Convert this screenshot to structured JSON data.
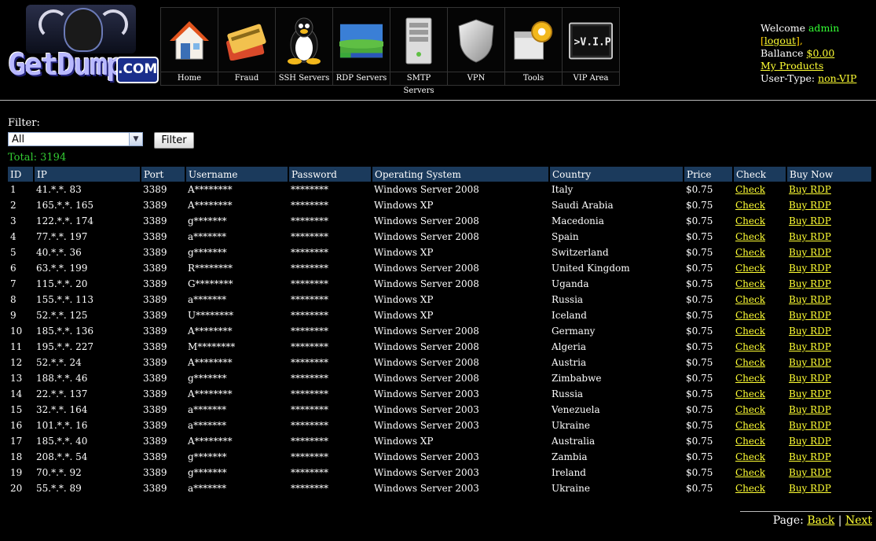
{
  "logo": {
    "text": "GetDumps",
    "suffix": ".COM"
  },
  "nav": [
    {
      "label": "Home",
      "icon": "house-icon"
    },
    {
      "label": "Fraud",
      "icon": "credit-cards-icon"
    },
    {
      "label": "SSH Servers",
      "icon": "linux-penguin-icon"
    },
    {
      "label": "RDP Servers",
      "icon": "windows-desktop-icon"
    },
    {
      "label": "SMTP Servers",
      "icon": "server-tower-icon"
    },
    {
      "label": "VPN",
      "icon": "shield-icon"
    },
    {
      "label": "Tools",
      "icon": "gear-box-icon"
    },
    {
      "label": "VIP Area",
      "icon": "vip-terminal-icon",
      "icon_text": ">V.I.P"
    }
  ],
  "user": {
    "welcome": "Welcome ",
    "username": "admin",
    "logout_pre": " [",
    "logout": "logout",
    "logout_post": "],",
    "balance_label": "Ballance ",
    "balance": "$0.00",
    "my_products": "My Products",
    "usertype_label": "User-Type: ",
    "usertype": "non-VIP"
  },
  "filter": {
    "label": "Filter:",
    "selected": "All",
    "button": "Filter"
  },
  "total": "Total: 3194",
  "table": {
    "headers": [
      "ID",
      "IP",
      "Port",
      "Username",
      "Password",
      "Operating System",
      "Country",
      "Price",
      "Check",
      "Buy Now"
    ],
    "rows": [
      [
        "1",
        "41.*.*. 83",
        "3389",
        "A********",
        "********",
        "Windows Server 2008",
        "Italy",
        "$0.75",
        "Check",
        "Buy RDP"
      ],
      [
        "2",
        "165.*.*. 165",
        "3389",
        "A********",
        "********",
        "Windows XP",
        "Saudi Arabia",
        "$0.75",
        "Check",
        "Buy RDP"
      ],
      [
        "3",
        "122.*.*. 174",
        "3389",
        "g*******",
        "********",
        "Windows Server 2008",
        "Macedonia",
        "$0.75",
        "Check",
        "Buy RDP"
      ],
      [
        "4",
        "77.*.*. 197",
        "3389",
        "a*******",
        "********",
        "Windows Server 2008",
        "Spain",
        "$0.75",
        "Check",
        "Buy RDP"
      ],
      [
        "5",
        "40.*.*. 36",
        "3389",
        "g*******",
        "********",
        "Windows XP",
        "Switzerland",
        "$0.75",
        "Check",
        "Buy RDP"
      ],
      [
        "6",
        "63.*.*. 199",
        "3389",
        "R********",
        "********",
        "Windows Server 2008",
        "United Kingdom",
        "$0.75",
        "Check",
        "Buy RDP"
      ],
      [
        "7",
        "115.*.*. 20",
        "3389",
        "G********",
        "********",
        "Windows Server 2008",
        "Uganda",
        "$0.75",
        "Check",
        "Buy RDP"
      ],
      [
        "8",
        "155.*.*. 113",
        "3389",
        "a*******",
        "********",
        "Windows XP",
        "Russia",
        "$0.75",
        "Check",
        "Buy RDP"
      ],
      [
        "9",
        "52.*.*. 125",
        "3389",
        "U********",
        "********",
        "Windows XP",
        "Iceland",
        "$0.75",
        "Check",
        "Buy RDP"
      ],
      [
        "10",
        "185.*.*. 136",
        "3389",
        "A********",
        "********",
        "Windows Server 2008",
        "Germany",
        "$0.75",
        "Check",
        "Buy RDP"
      ],
      [
        "11",
        "195.*.*. 227",
        "3389",
        "M********",
        "********",
        "Windows Server 2008",
        "Algeria",
        "$0.75",
        "Check",
        "Buy RDP"
      ],
      [
        "12",
        "52.*.*. 24",
        "3389",
        "A********",
        "********",
        "Windows Server 2008",
        "Austria",
        "$0.75",
        "Check",
        "Buy RDP"
      ],
      [
        "13",
        "188.*.*. 46",
        "3389",
        "g*******",
        "********",
        "Windows Server 2008",
        "Zimbabwe",
        "$0.75",
        "Check",
        "Buy RDP"
      ],
      [
        "14",
        "22.*.*. 137",
        "3389",
        "A********",
        "********",
        "Windows Server 2003",
        "Russia",
        "$0.75",
        "Check",
        "Buy RDP"
      ],
      [
        "15",
        "32.*.*. 164",
        "3389",
        "a*******",
        "********",
        "Windows Server 2003",
        "Venezuela",
        "$0.75",
        "Check",
        "Buy RDP"
      ],
      [
        "16",
        "101.*.*. 16",
        "3389",
        "a*******",
        "********",
        "Windows Server 2003",
        "Ukraine",
        "$0.75",
        "Check",
        "Buy RDP"
      ],
      [
        "17",
        "185.*.*. 40",
        "3389",
        "A********",
        "********",
        "Windows XP",
        "Australia",
        "$0.75",
        "Check",
        "Buy RDP"
      ],
      [
        "18",
        "208.*.*. 54",
        "3389",
        "g*******",
        "********",
        "Windows Server 2003",
        "Zambia",
        "$0.75",
        "Check",
        "Buy RDP"
      ],
      [
        "19",
        "70.*.*. 92",
        "3389",
        "g*******",
        "********",
        "Windows Server 2003",
        "Ireland",
        "$0.75",
        "Check",
        "Buy RDP"
      ],
      [
        "20",
        "55.*.*. 89",
        "3389",
        "a*******",
        "********",
        "Windows Server 2003",
        "Ukraine",
        "$0.75",
        "Check",
        "Buy RDP"
      ]
    ]
  },
  "pager": {
    "label": "Page: ",
    "back": "Back",
    "sep": " | ",
    "next": "Next"
  },
  "colors": {
    "background": "#000000",
    "link": "#ffff33",
    "header_bg": "#1b3a5c",
    "total": "#33cc33",
    "username": "#33ff33"
  }
}
